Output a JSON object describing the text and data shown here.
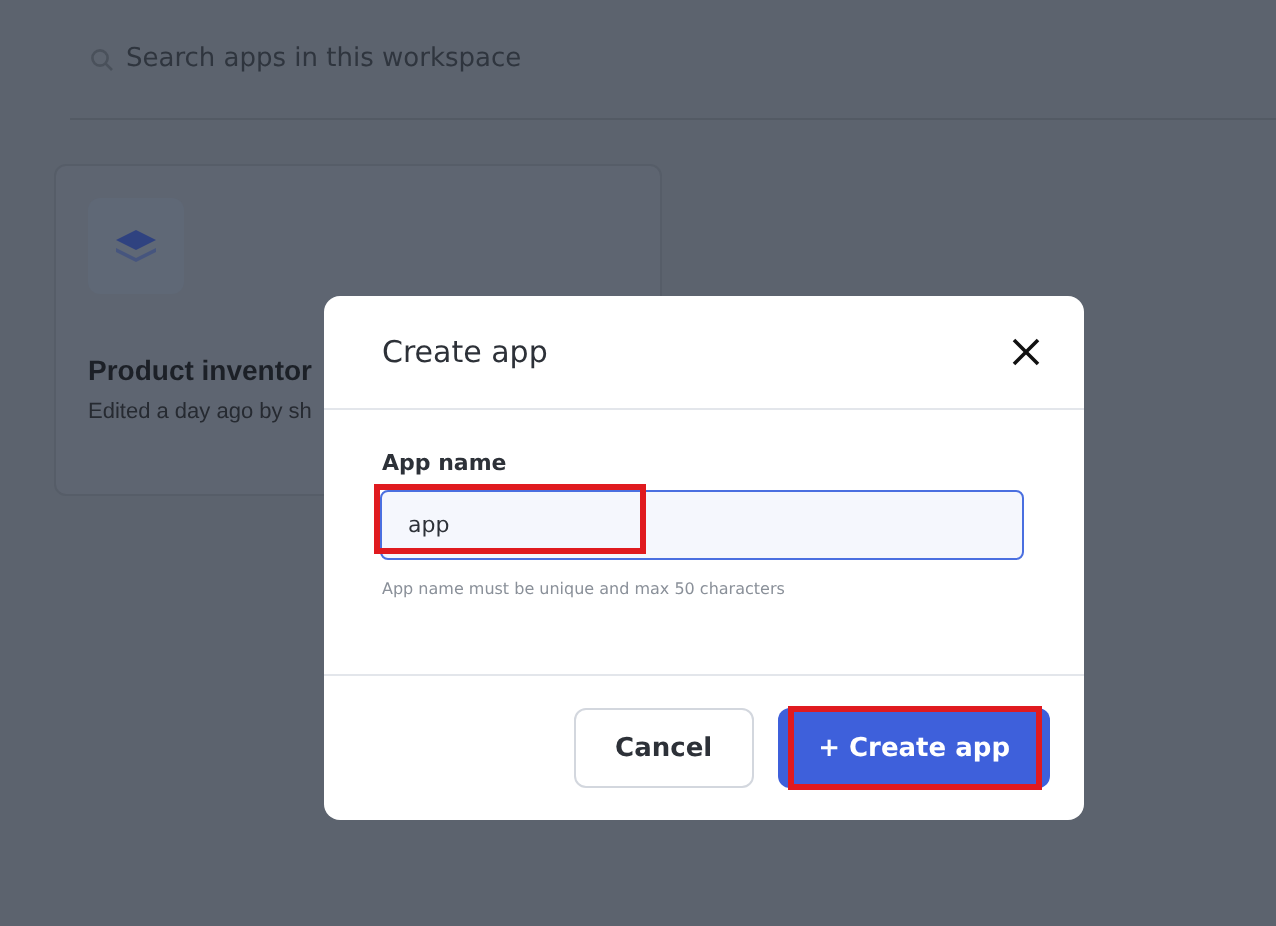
{
  "search": {
    "placeholder": "Search apps in this workspace"
  },
  "apps": [
    {
      "title": "Product inventor",
      "subtitle": "Edited a day ago by sh"
    }
  ],
  "dialog": {
    "title": "Create app",
    "field": {
      "label": "App name",
      "value": "app",
      "hint": "App name must be unique and max 50 characters",
      "highlighted": true
    },
    "buttons": [
      {
        "label": "Cancel",
        "kind": "secondary",
        "highlighted": false
      },
      {
        "label": "+ Create app",
        "kind": "primary",
        "highlighted": true
      }
    ]
  }
}
